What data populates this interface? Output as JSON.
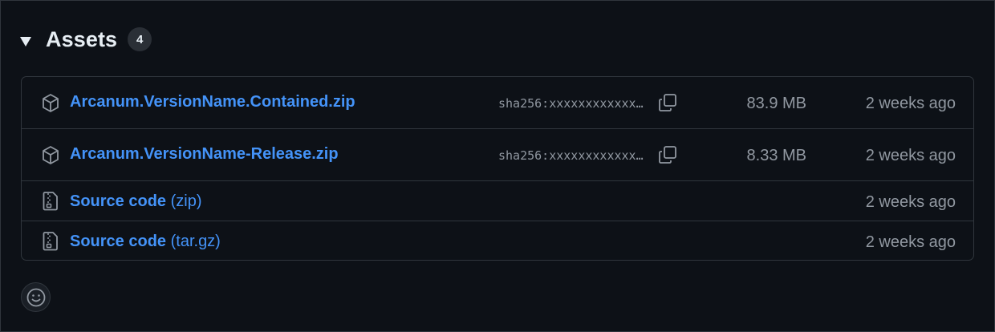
{
  "assets": {
    "title": "Assets",
    "count": "4",
    "rows": [
      {
        "icon": "package-icon",
        "name": "Arcanum.VersionName.Contained.zip",
        "sha": "sha256:xxxxxxxxxxxxxxxxxxxxxxxxxxxxxxxx",
        "size": "83.9 MB",
        "date": "2 weeks ago"
      },
      {
        "icon": "package-icon",
        "name": "Arcanum.VersionName-Release.zip",
        "sha": "sha256:xxxxxxxxxxxxxxxxxxxxxxxxxxxxxxxx",
        "size": "8.33 MB",
        "date": "2 weeks ago"
      },
      {
        "icon": "file-zip-icon",
        "name": "Source code",
        "suffix": "(zip)",
        "date": "2 weeks ago"
      },
      {
        "icon": "file-zip-icon",
        "name": "Source code",
        "suffix": "(tar.gz)",
        "date": "2 weeks ago"
      }
    ]
  },
  "reactions": {
    "icon": "smiley-icon"
  },
  "colors": {
    "background": "#0d1117",
    "border": "#30363d",
    "link": "#4493f8",
    "muted": "#9198a1",
    "text": "#e6edf3"
  }
}
